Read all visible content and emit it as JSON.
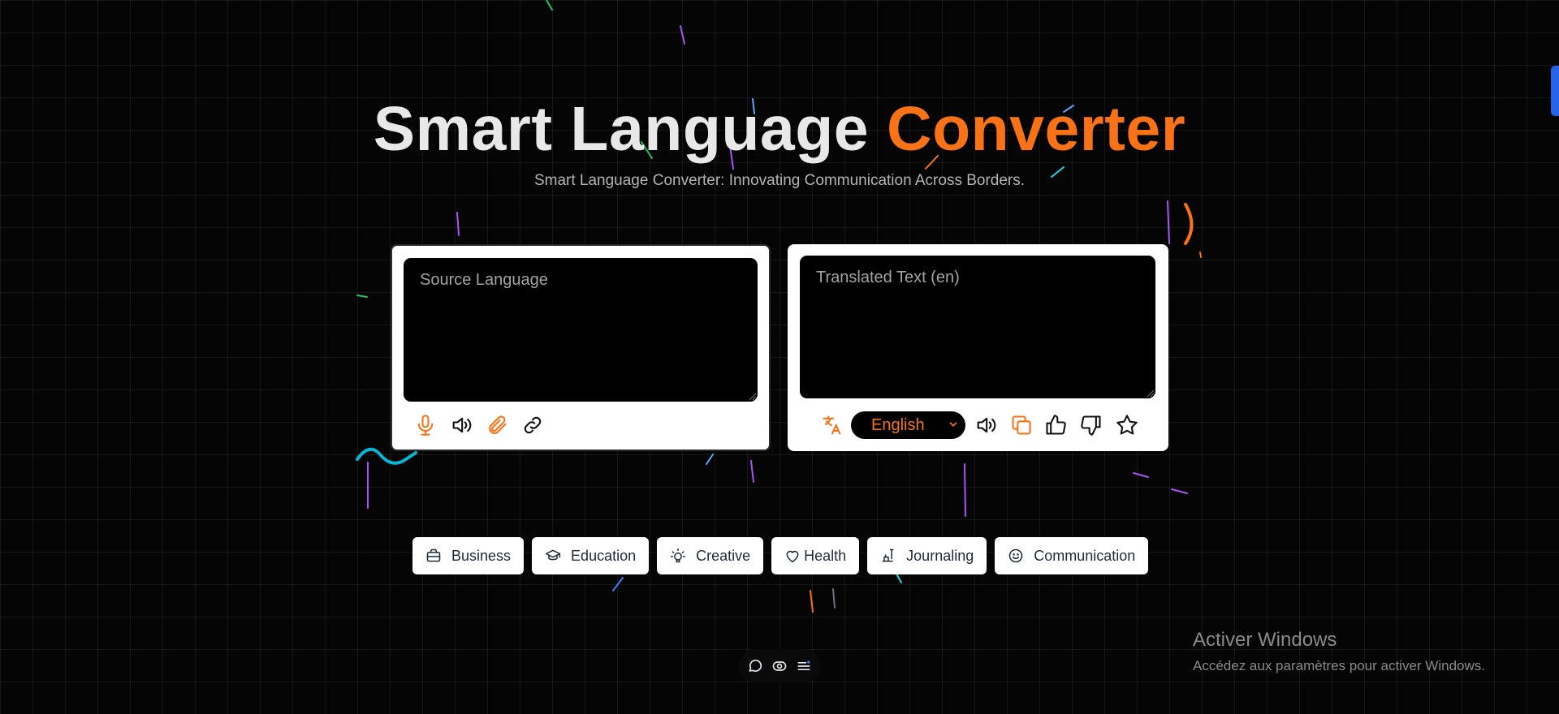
{
  "header": {
    "title_main": "Smart Language ",
    "title_accent": "Converter",
    "subtitle": "Smart Language Converter: Innovating Communication Across Borders."
  },
  "source_panel": {
    "placeholder": "Source Language",
    "value": "",
    "tools": [
      "microphone-icon",
      "speaker-icon",
      "paperclip-icon",
      "link-icon"
    ]
  },
  "target_panel": {
    "placeholder": "Translated Text (en)",
    "value": "",
    "language_select": {
      "selected": "English"
    },
    "tools": [
      "translate-icon",
      "speaker-icon",
      "copy-icon",
      "thumbs-up-icon",
      "thumbs-down-icon",
      "star-icon"
    ]
  },
  "categories": [
    {
      "label": "Business",
      "icon": "briefcase-icon"
    },
    {
      "label": "Education",
      "icon": "graduation-cap-icon"
    },
    {
      "label": "Creative",
      "icon": "lightbulb-icon"
    },
    {
      "label": "Health",
      "icon": "heart-icon"
    },
    {
      "label": "Journaling",
      "icon": "pen-icon"
    },
    {
      "label": "Communication",
      "icon": "smile-icon"
    }
  ],
  "bottom_bar": [
    "chat-icon",
    "eye-icon",
    "menu-icon"
  ],
  "watermark": {
    "line1": "Activer Windows",
    "line2": "Accédez aux paramètres pour activer Windows."
  },
  "colors": {
    "accent": "#f97316",
    "background": "#050505",
    "card": "#ffffff"
  }
}
